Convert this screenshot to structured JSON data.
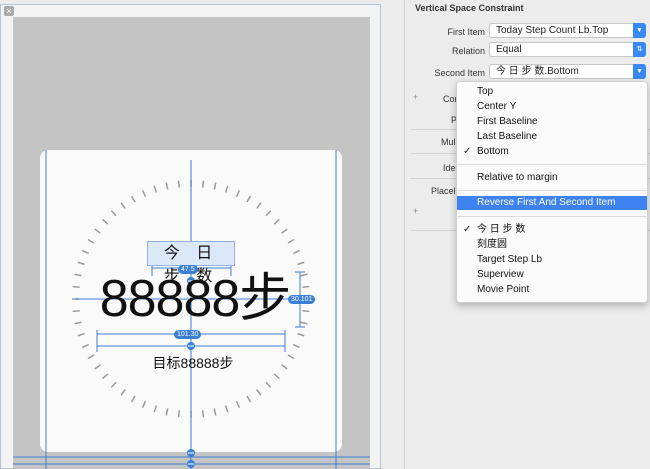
{
  "canvas": {
    "labels": {
      "today": "今 日 步 数",
      "count": "88888步",
      "target": "目标88888步"
    },
    "badges": {
      "top": "47.5",
      "right": "30.101",
      "width": "101.30"
    }
  },
  "inspector": {
    "title": "Vertical Space Constraint",
    "first_item_label": "First Item",
    "first_item_value": "Today Step Count Lb.Top",
    "relation_label": "Relation",
    "relation_value": "Equal",
    "second_item_label": "Second Item",
    "second_item_value": "今 日 步 数.Bottom",
    "plus": "+",
    "cutoff": [
      "Con",
      "P",
      "Mul",
      "Ide",
      "Placel"
    ]
  },
  "menu": {
    "attributes": [
      "Top",
      "Center Y",
      "First Baseline",
      "Last Baseline",
      "Bottom"
    ],
    "selected_attribute": "Bottom",
    "relative_to_margin": "Relative to margin",
    "reverse": "Reverse First And Second Item",
    "items": [
      "今 日 步 数",
      "刻度圆",
      "Target Step Lb",
      "Superview",
      "Movie Point"
    ],
    "selected_item": "今 日 步 数",
    "checkmark": "✓",
    "highlight_color": "#3d82f0"
  }
}
